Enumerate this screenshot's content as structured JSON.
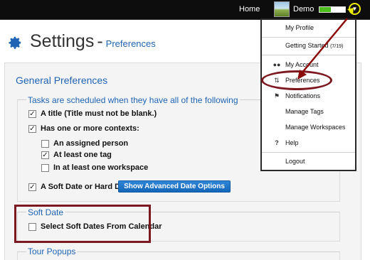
{
  "topbar": {
    "home": "Home",
    "user": "Demo",
    "progress": 0.45
  },
  "header": {
    "title": "Settings",
    "separator": "-",
    "subtitle": "Preferences"
  },
  "general": {
    "title": "General Preferences",
    "tasks_legend": "Tasks are scheduled when they have all of the following",
    "items": [
      {
        "label": "A title (Title must not be blank.)",
        "checked": true
      },
      {
        "label": "Has one or more contexts:",
        "checked": true
      },
      {
        "label": "An assigned person",
        "checked": false
      },
      {
        "label": "At least one tag",
        "checked": true
      },
      {
        "label": "In at least one workspace",
        "checked": false
      },
      {
        "label": "A Soft Date or Hard Date",
        "checked": true
      }
    ],
    "advanced_button": "Show Advanced Date Options"
  },
  "soft_date": {
    "legend": "Soft Date",
    "label": "Select Soft Dates From Calendar",
    "checked": false
  },
  "tour": {
    "legend": "Tour Popups"
  },
  "menu": {
    "my_profile": "My Profile",
    "getting_started": "Getting Started",
    "getting_started_count": "(7/19)",
    "my_account": "My Account",
    "preferences": "Preferences",
    "notifications": "Notifications",
    "manage_tags": "Manage Tags",
    "manage_workspaces": "Manage Workspaces",
    "help": "Help",
    "logout": "Logout"
  },
  "colors": {
    "accent": "#1f64b4",
    "highlight": "#7e1820",
    "arrow": "#8b0a0a",
    "callout": "#e8e800"
  }
}
